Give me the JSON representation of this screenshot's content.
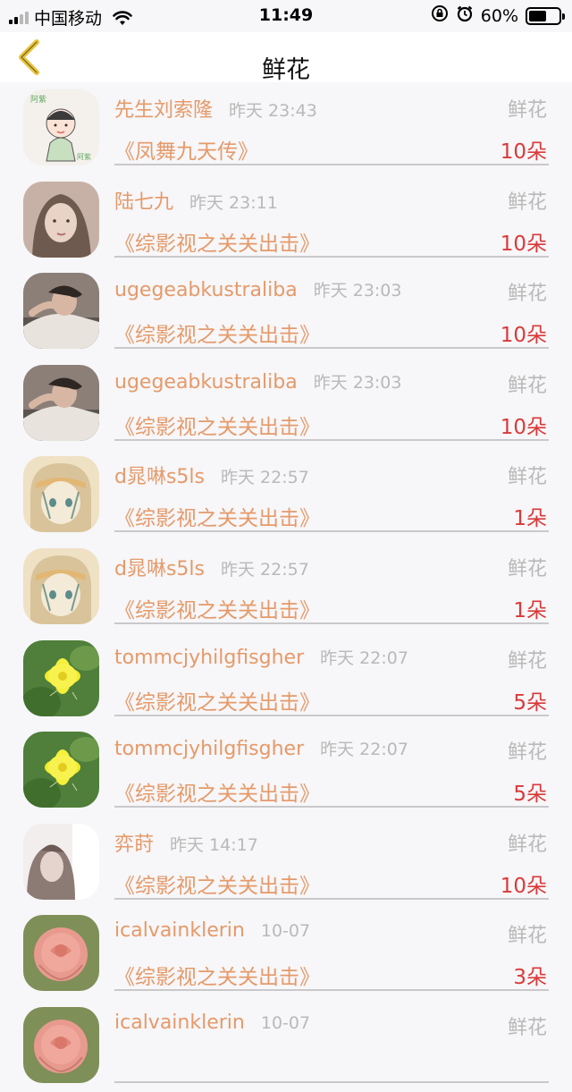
{
  "status_bar": {
    "carrier": "中国移动",
    "time": "11:49",
    "battery": "60%",
    "battery_level": 0.6
  },
  "nav": {
    "title": "鲜花"
  },
  "items": [
    {
      "user": "先生刘索隆",
      "time": "昨天 23:43",
      "type": "鲜花",
      "book": "《凤舞九天传》",
      "count": "10朵",
      "avatar": "cartoon-sketch"
    },
    {
      "user": "陆七九",
      "time": "昨天 23:11",
      "type": "鲜花",
      "book": "《综影视之关关出击》",
      "count": "10朵",
      "avatar": "portrait-girl"
    },
    {
      "user": "ugegeabkustraliba",
      "time": "昨天 23:03",
      "type": "鲜花",
      "book": "《综影视之关关出击》",
      "count": "10朵",
      "avatar": "portrait-lying"
    },
    {
      "user": "ugegeabkustraliba",
      "time": "昨天 23:03",
      "type": "鲜花",
      "book": "《综影视之关关出击》",
      "count": "10朵",
      "avatar": "portrait-lying"
    },
    {
      "user": "d晁啉s5ls",
      "time": "昨天 22:57",
      "type": "鲜花",
      "book": "《综影视之关关出击》",
      "count": "1朵",
      "avatar": "anime-girl"
    },
    {
      "user": "d晁啉s5ls",
      "time": "昨天 22:57",
      "type": "鲜花",
      "book": "《综影视之关关出击》",
      "count": "1朵",
      "avatar": "anime-girl"
    },
    {
      "user": "tommcjyhilgfisgher",
      "time": "昨天 22:07",
      "type": "鲜花",
      "book": "《综影视之关关出击》",
      "count": "5朵",
      "avatar": "yellow-flower"
    },
    {
      "user": "tommcjyhilgfisgher",
      "time": "昨天 22:07",
      "type": "鲜花",
      "book": "《综影视之关关出击》",
      "count": "5朵",
      "avatar": "yellow-flower"
    },
    {
      "user": "弈莳",
      "time": "昨天 14:17",
      "type": "鲜花",
      "book": "《综影视之关关出击》",
      "count": "10朵",
      "avatar": "portrait-light"
    },
    {
      "user": "icalvainklerin",
      "time": "10-07",
      "type": "鲜花",
      "book": "《综影视之关关出击》",
      "count": "3朵",
      "avatar": "pink-rose"
    },
    {
      "user": "icalvainklerin",
      "time": "10-07",
      "type": "鲜花",
      "book": "",
      "count": "",
      "avatar": "pink-rose"
    }
  ]
}
